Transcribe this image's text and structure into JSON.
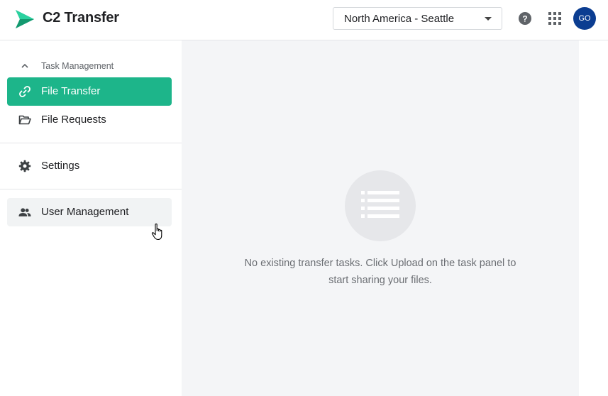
{
  "app": {
    "title": "C2 Transfer",
    "brand_color": "#1db58a"
  },
  "header": {
    "region": {
      "selected": "North America - Seattle"
    },
    "help_icon": "help-circle-icon",
    "apps_icon": "grid-icon",
    "avatar_initials": "GO",
    "avatar_color": "#0b3d91"
  },
  "sidebar": {
    "section": {
      "label": "Task Management",
      "expanded": true
    },
    "items": [
      {
        "label": "File Transfer",
        "icon": "link-icon",
        "active": true
      },
      {
        "label": "File Requests",
        "icon": "folder-open-icon",
        "active": false
      },
      {
        "label": "Settings",
        "icon": "gear-icon",
        "active": false
      },
      {
        "label": "User Management",
        "icon": "users-icon",
        "active": false,
        "hovered": true
      }
    ]
  },
  "main": {
    "empty_icon": "list-icon",
    "empty_message_line1": "No existing transfer tasks. Click Upload on the task panel to",
    "empty_message_line2": "start sharing your files."
  }
}
